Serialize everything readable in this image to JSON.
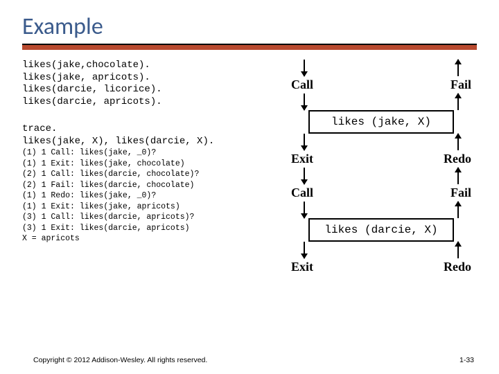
{
  "title": "Example",
  "facts": "likes(jake,chocolate).\nlikes(jake, apricots).\nlikes(darcie, licorice).\nlikes(darcie, apricots).",
  "query": "trace.\nlikes(jake, X), likes(darcie, X).",
  "trace": "(1) 1 Call: likes(jake, _0)?\n(1) 1 Exit: likes(jake, chocolate)\n(2) 1 Call: likes(darcie, chocolate)?\n(2) 1 Fail: likes(darcie, chocolate)\n(1) 1 Redo: likes(jake, _0)?\n(1) 1 Exit: likes(jake, apricots)\n(3) 1 Call: likes(darcie, apricots)?\n(3) 1 Exit: likes(darcie, apricots)\nX = apricots",
  "diagram": {
    "port": {
      "call": "Call",
      "fail": "Fail",
      "exit": "Exit",
      "redo": "Redo"
    },
    "box1": "likes (jake, X)",
    "box2": "likes (darcie, X)"
  },
  "footer": {
    "copyright": "Copyright © 2012 Addison-Wesley. All rights reserved.",
    "page": "1-33"
  }
}
